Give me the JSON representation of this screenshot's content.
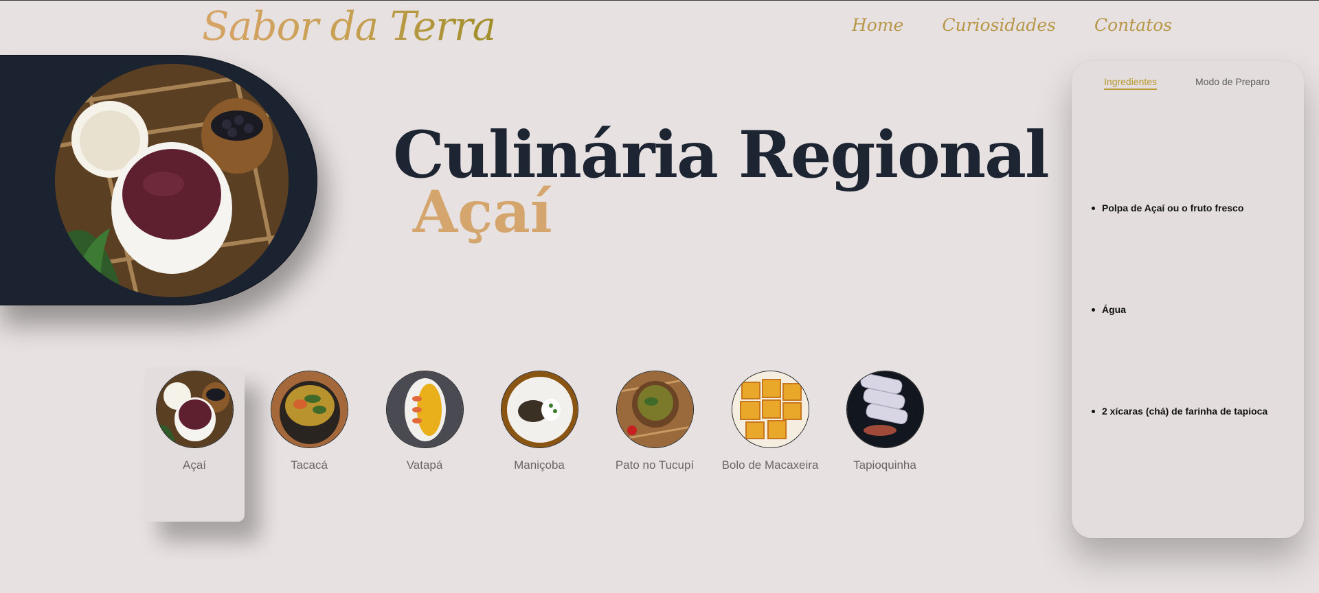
{
  "header": {
    "logo": "Sabor da Terra",
    "nav": [
      "Home",
      "Curiosidades",
      "Contatos"
    ]
  },
  "hero": {
    "title": "Culinária Regional",
    "subtitle": "Açaí"
  },
  "dishes": [
    {
      "label": "Açaí",
      "active": true
    },
    {
      "label": "Tacacá"
    },
    {
      "label": "Vatapá"
    },
    {
      "label": "Maniçoba"
    },
    {
      "label": "Pato no Tucupí"
    },
    {
      "label": "Bolo de Macaxeira"
    },
    {
      "label": "Tapioquinha"
    }
  ],
  "panel": {
    "tabs": [
      "Ingredientes",
      "Modo de Preparo"
    ],
    "active_tab": "Ingredientes",
    "ingredients": [
      "Polpa de Açaí ou o fruto fresco",
      "Água",
      "2 xícaras (chá) de farinha de tapioca"
    ]
  },
  "colors": {
    "background": "#e7e1e1",
    "dark": "#1d2532",
    "gold": "#b89648",
    "accent": "#d4a56c"
  }
}
